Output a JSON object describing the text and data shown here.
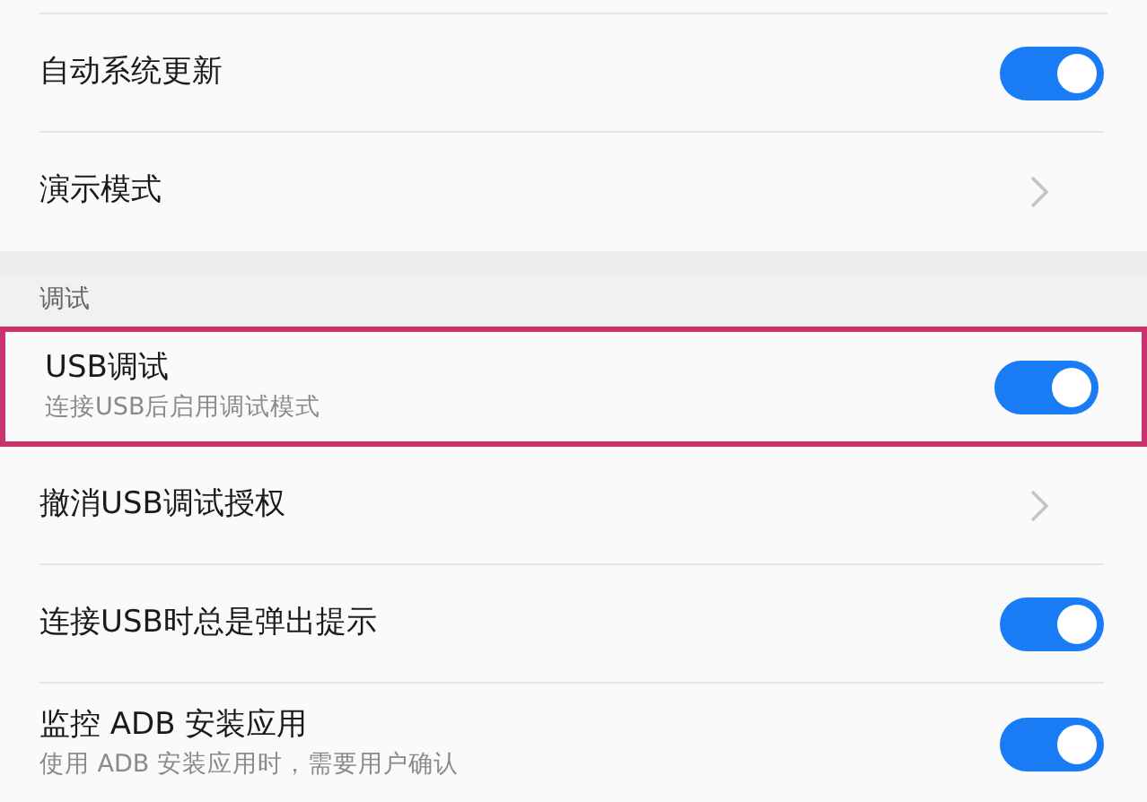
{
  "sections": [
    {
      "items": [
        {
          "kind": "toggle",
          "title": "自动系统更新",
          "on": true,
          "highlighted": false
        },
        {
          "kind": "link",
          "title": "演示模式",
          "highlighted": false
        }
      ]
    },
    {
      "header": "调试",
      "items": [
        {
          "kind": "toggle",
          "title": "USB调试",
          "subtitle": "连接USB后启用调试模式",
          "on": true,
          "highlighted": true
        },
        {
          "kind": "link",
          "title": "撤消USB调试授权",
          "highlighted": false
        },
        {
          "kind": "toggle",
          "title": "连接USB时总是弹出提示",
          "on": true,
          "highlighted": false
        },
        {
          "kind": "toggle",
          "title": "监控 ADB 安装应用",
          "subtitle": "使用 ADB 安装应用时，需要用户确认",
          "on": true,
          "highlighted": false
        }
      ]
    }
  ]
}
